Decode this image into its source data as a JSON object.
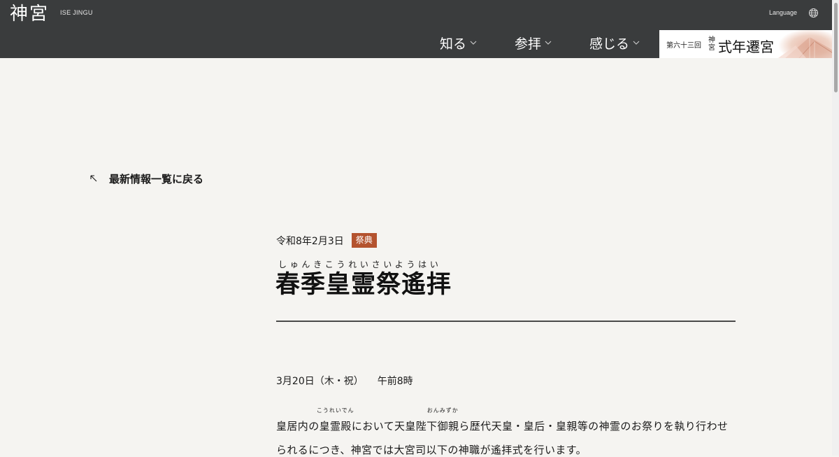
{
  "header": {
    "logo": "神宮",
    "site_name": "ISE JINGU",
    "language_label": "Language",
    "globe_icon": "globe-icon"
  },
  "nav": {
    "items": [
      {
        "label": "知る"
      },
      {
        "label": "参拝"
      },
      {
        "label": "感じる"
      }
    ],
    "chevron_icon": "chevron-down-icon"
  },
  "banner": {
    "nth": "第六十三回",
    "small": "神宮",
    "title": "式年遷宮"
  },
  "back_link": {
    "label": "最新情報一覧に戻る",
    "icon": "arrow-up-left-icon"
  },
  "article": {
    "date": "令和8年2月3日",
    "category": "祭典",
    "category_color": "#b4532f",
    "title_ruby": "しゅんきこうれいさいようはい",
    "title": "春季皇霊祭遙拝",
    "schedule_date": "3月20日（木・祝）",
    "schedule_time": "午前8時",
    "body_part1": "皇居内の",
    "ruby_word1": "皇霊殿",
    "ruby_reading1": "こうれいでん",
    "body_part2": "において天皇陛下",
    "ruby_word2": "御",
    "ruby_reading2": "おんみずか",
    "body_part3": "親ら歴代天皇・皇后・皇親等の神霊のお祭りを執り行わせ",
    "body_line2": "られるにつき、神宮では大宮司以下の神職が遙拝式を行います。"
  },
  "colors": {
    "header_bg": "#3a3c3d",
    "page_bg": "#f5f4f1"
  }
}
